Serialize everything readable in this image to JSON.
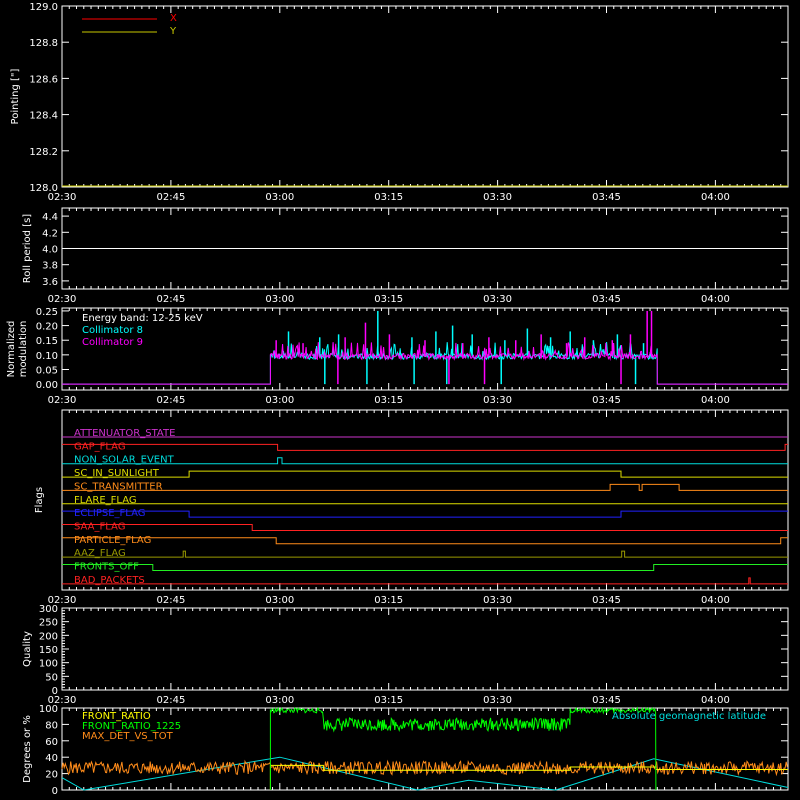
{
  "x_axis": {
    "range_minutes": [
      0,
      100
    ],
    "start_time": "02:30",
    "ticks": [
      {
        "label": "02:30",
        "min": 0
      },
      {
        "label": "02:45",
        "min": 15
      },
      {
        "label": "03:00",
        "min": 30
      },
      {
        "label": "03:15",
        "min": 45
      },
      {
        "label": "03:30",
        "min": 60
      },
      {
        "label": "03:45",
        "min": 75
      },
      {
        "label": "04:00",
        "min": 90
      }
    ]
  },
  "colors": {
    "axis": "#ffffff",
    "x": "#ff0000",
    "y": "#c8c800",
    "c8": "#00ffff",
    "c9": "#ff00ff",
    "front_ratio": "#ffff00",
    "front_ratio_1225": "#00ff00",
    "max_det": "#ff8c1a",
    "geolat": "#00dddd"
  },
  "chart_data": [
    {
      "id": "pointing",
      "type": "line",
      "ylabel": "Pointing [\"]",
      "ylim": [
        128.0,
        129.0
      ],
      "yticks": [
        "128.0",
        "128.2",
        "128.4",
        "128.6",
        "128.8",
        "129.0"
      ],
      "legend": [
        {
          "name": "X",
          "color": "#ff0000"
        },
        {
          "name": "Y",
          "color": "#c8c800"
        }
      ],
      "series": [
        {
          "name": "X",
          "color": "#ff0000",
          "points": [
            [
              0,
              128.0
            ],
            [
              100,
              128.0
            ]
          ]
        },
        {
          "name": "Y",
          "color": "#c8c800",
          "points": [
            [
              0,
              128.0
            ],
            [
              100,
              128.0
            ]
          ]
        }
      ]
    },
    {
      "id": "roll",
      "type": "line",
      "ylabel": "Roll period [s]",
      "ylim": [
        3.5,
        4.5
      ],
      "yticks": [
        "3.6",
        "3.8",
        "4.0",
        "4.2",
        "4.4"
      ],
      "series": [
        {
          "name": "roll",
          "color": "#ffffff",
          "points": [
            [
              0,
              4.0
            ],
            [
              100,
              4.0
            ]
          ]
        }
      ]
    },
    {
      "id": "modulation",
      "type": "line",
      "ylabel_lines": [
        "Normalized",
        "modulation"
      ],
      "ylim": [
        -0.02,
        0.26
      ],
      "yticks": [
        "0.00",
        "0.05",
        "0.10",
        "0.15",
        "0.20",
        "0.25"
      ],
      "annotation": "Energy band: 12-25 keV",
      "legend": [
        {
          "name": "Collimator 8",
          "color": "#00ffff"
        },
        {
          "name": "Collimator 9",
          "color": "#ff00ff"
        }
      ],
      "active_range": [
        28.7,
        82.0
      ],
      "baseline": 0.095,
      "series": [
        {
          "name": "Collimator 8",
          "color": "#00ffff",
          "dropouts": [
            36.2,
            42.0,
            48.5,
            53.0,
            60.5,
            79.0
          ],
          "spikes": [
            [
              31.2,
              0.18
            ],
            [
              35.5,
              0.16
            ],
            [
              38.1,
              0.17
            ],
            [
              43.5,
              0.25
            ],
            [
              48.2,
              0.16
            ],
            [
              51.5,
              0.18
            ],
            [
              53.8,
              0.2
            ],
            [
              56.5,
              0.17
            ],
            [
              61.0,
              0.15
            ],
            [
              64.1,
              0.19
            ],
            [
              67.3,
              0.16
            ],
            [
              70.0,
              0.18
            ],
            [
              73.2,
              0.15
            ],
            [
              76.5,
              0.17
            ],
            [
              80.1,
              0.14
            ]
          ]
        },
        {
          "name": "Collimator 9",
          "color": "#ff00ff",
          "dropouts": [
            38.0,
            53.3,
            58.2,
            77.0
          ],
          "spikes": [
            [
              29.5,
              0.15
            ],
            [
              33.2,
              0.14
            ],
            [
              39.0,
              0.16
            ],
            [
              41.8,
              0.21
            ],
            [
              45.1,
              0.17
            ],
            [
              50.0,
              0.15
            ],
            [
              55.2,
              0.14
            ],
            [
              58.8,
              0.16
            ],
            [
              62.5,
              0.15
            ],
            [
              66.0,
              0.17
            ],
            [
              69.5,
              0.14
            ],
            [
              72.0,
              0.16
            ],
            [
              75.8,
              0.15
            ],
            [
              78.3,
              0.17
            ],
            [
              80.6,
              0.25
            ],
            [
              81.2,
              0.25
            ]
          ]
        }
      ]
    },
    {
      "id": "flags",
      "type": "line",
      "ylabel": "Flags",
      "flags": [
        {
          "name": "ATTENUATOR_STATE",
          "color": "#cc33cc",
          "transitions": [
            [
              0,
              0
            ]
          ]
        },
        {
          "name": "GAP_FLAG",
          "color": "#ff2222",
          "transitions": [
            [
              0,
              1
            ],
            [
              29.7,
              0
            ],
            [
              99.6,
              1
            ]
          ]
        },
        {
          "name": "NON_SOLAR_EVENT",
          "color": "#00dddd",
          "transitions": [
            [
              0,
              0
            ],
            [
              29.7,
              1
            ],
            [
              30.3,
              0
            ]
          ]
        },
        {
          "name": "SC_IN_SUNLIGHT",
          "color": "#dddd00",
          "transitions": [
            [
              0,
              0
            ],
            [
              17.5,
              1
            ],
            [
              77.0,
              0
            ]
          ]
        },
        {
          "name": "SC_TRANSMITTER",
          "color": "#ff8c1a",
          "transitions": [
            [
              0,
              0
            ],
            [
              75.5,
              1
            ],
            [
              79.5,
              0
            ],
            [
              79.9,
              1
            ],
            [
              85.0,
              0
            ]
          ]
        },
        {
          "name": "FLARE_FLAG",
          "color": "#dddd00",
          "transitions": [
            [
              0,
              0
            ]
          ]
        },
        {
          "name": "ECLIPSE_FLAG",
          "color": "#2222ff",
          "transitions": [
            [
              0,
              1
            ],
            [
              17.5,
              0
            ],
            [
              77.0,
              1
            ]
          ]
        },
        {
          "name": "SAA_FLAG",
          "color": "#ff2222",
          "transitions": [
            [
              0,
              1
            ],
            [
              26.2,
              0
            ]
          ]
        },
        {
          "name": "PARTICLE_FLAG",
          "color": "#ff8c1a",
          "transitions": [
            [
              0,
              1
            ],
            [
              29.5,
              0
            ],
            [
              99.0,
              1
            ]
          ]
        },
        {
          "name": "AAZ_FLAG",
          "color": "#999900",
          "transitions": [
            [
              0,
              0
            ],
            [
              16.7,
              1
            ],
            [
              17.0,
              0
            ],
            [
              77.1,
              1
            ],
            [
              77.5,
              0
            ]
          ]
        },
        {
          "name": "FRONTS_OFF",
          "color": "#22ee22",
          "transitions": [
            [
              0,
              1
            ],
            [
              12.5,
              0
            ],
            [
              81.5,
              1
            ]
          ]
        },
        {
          "name": "BAD_PACKETS",
          "color": "#ff2222",
          "transitions": [
            [
              0,
              0
            ],
            [
              94.6,
              1
            ],
            [
              94.8,
              0
            ]
          ]
        }
      ]
    },
    {
      "id": "quality",
      "type": "line",
      "ylabel": "Quality",
      "ylim": [
        0,
        300
      ],
      "yticks": [
        "0",
        "50",
        "100",
        "150",
        "200",
        "250",
        "300"
      ],
      "series": []
    },
    {
      "id": "ratios",
      "type": "line",
      "ylabel": "Degrees or %",
      "ylim": [
        0,
        100
      ],
      "yticks": [
        "0",
        "20",
        "40",
        "60",
        "80",
        "100"
      ],
      "legend": [
        {
          "name": "FRONT_RATIO",
          "color": "#ffff00"
        },
        {
          "name": "FRONT_RATIO_1225",
          "color": "#00ff00"
        },
        {
          "name": "MAX_DET_VS_TOT",
          "color": "#ff8c1a"
        }
      ],
      "right_legend": {
        "name": "Absolute geomagnetic latitude",
        "color": "#00dddd"
      },
      "series": [
        {
          "name": "FRONT_RATIO_1225",
          "color": "#00ff00",
          "levels": [
            [
              28.7,
              97
            ],
            [
              36.0,
              80
            ],
            [
              70.0,
              97
            ],
            [
              81.8,
              0
            ]
          ]
        },
        {
          "name": "FRONT_RATIO",
          "color": "#ffff00",
          "levels": [
            [
              28.7,
              30
            ],
            [
              36.0,
              24
            ],
            [
              70.0,
              28
            ],
            [
              81.8,
              25
            ],
            [
              100,
              25
            ]
          ]
        },
        {
          "name": "MAX_DET_VS_TOT",
          "color": "#ff8c1a",
          "start": 0,
          "end": 100,
          "mean": 27,
          "amp": 8
        },
        {
          "name": "Absolute geomagnetic latitude",
          "color": "#00dddd",
          "points": [
            [
              0,
              15
            ],
            [
              3,
              0
            ],
            [
              30,
              40
            ],
            [
              49,
              0
            ],
            [
              56,
              12
            ],
            [
              68,
              0
            ],
            [
              81.5,
              38
            ],
            [
              100,
              3
            ]
          ]
        }
      ]
    }
  ]
}
